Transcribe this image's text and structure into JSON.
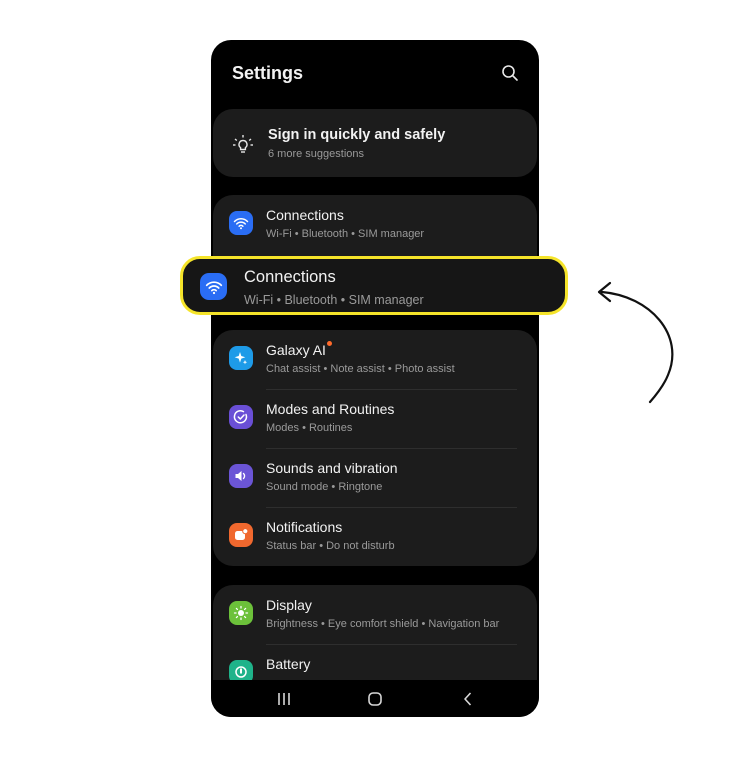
{
  "header": {
    "title": "Settings"
  },
  "suggestion": {
    "title": "Sign in quickly and safely",
    "subtitle": "6 more suggestions"
  },
  "items": [
    {
      "title": "Connections",
      "subtitle": "Wi-Fi  •  Bluetooth  •  SIM manager",
      "icon": "wifi-icon",
      "color": "#2a6df4"
    },
    {
      "title": "Galaxy AI",
      "subtitle": "Chat assist  •  Note assist  •  Photo assist",
      "icon": "sparkle-icon",
      "color": "#1e9be8"
    },
    {
      "title": "Modes and Routines",
      "subtitle": "Modes  •  Routines",
      "icon": "check-circle-icon",
      "color": "#6a4fd6"
    },
    {
      "title": "Sounds and vibration",
      "subtitle": "Sound mode  •  Ringtone",
      "icon": "speaker-icon",
      "color": "#6b55d6"
    },
    {
      "title": "Notifications",
      "subtitle": "Status bar  •  Do not disturb",
      "icon": "notification-icon",
      "color": "#f0682e"
    },
    {
      "title": "Display",
      "subtitle": "Brightness  •  Eye comfort shield  •  Navigation bar",
      "icon": "sun-icon",
      "color": "#6cc13a"
    },
    {
      "title": "Battery",
      "subtitle": "",
      "icon": "battery-icon",
      "color": "#1fb38a"
    }
  ],
  "highlight": {
    "title": "Connections",
    "subtitle": "Wi-Fi  •  Bluetooth  •  SIM manager",
    "border_color": "#f5e42a"
  },
  "navbar": {
    "icons": [
      "recent-apps-icon",
      "home-icon",
      "back-icon"
    ]
  }
}
